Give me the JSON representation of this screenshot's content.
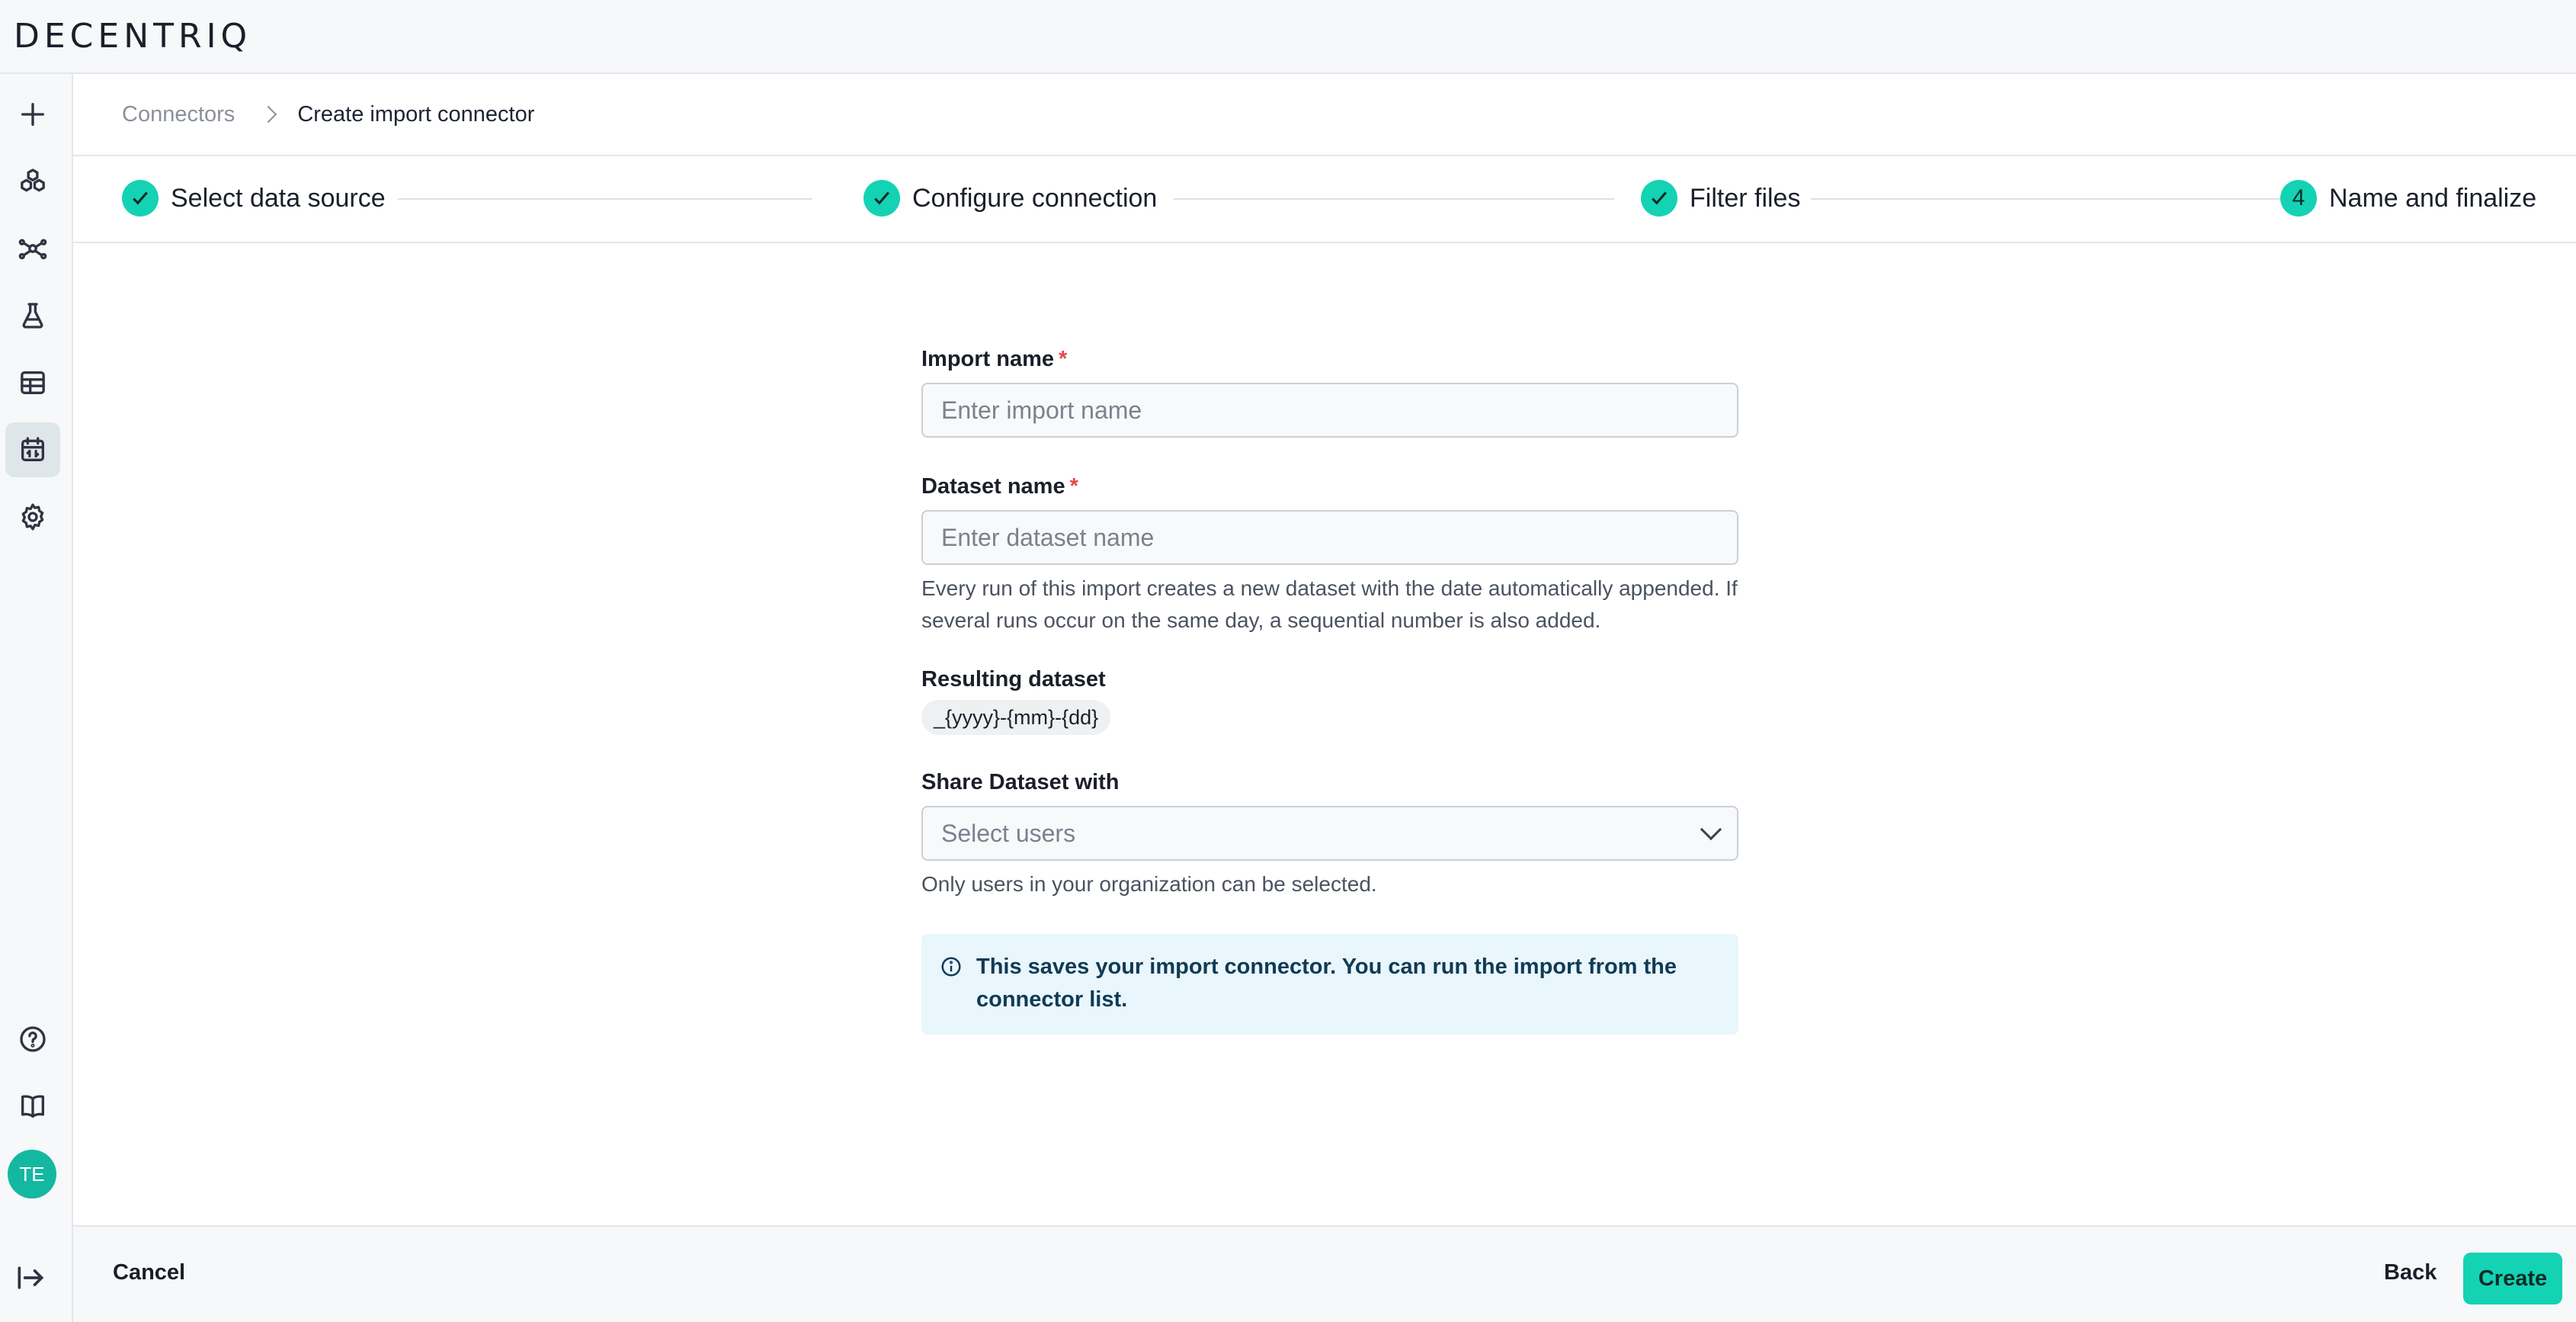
{
  "app": {
    "logo": "DECENTRIQ"
  },
  "sidebar": {
    "items": [
      {
        "icon": "plus-icon"
      },
      {
        "icon": "datarooms-icon"
      },
      {
        "icon": "network-icon"
      },
      {
        "icon": "flask-icon"
      },
      {
        "icon": "table-icon"
      },
      {
        "icon": "connectors-icon",
        "active": true
      },
      {
        "icon": "gear-icon"
      }
    ],
    "bottom": [
      {
        "icon": "help-icon"
      },
      {
        "icon": "book-icon"
      }
    ],
    "avatar": "TE"
  },
  "breadcrumb": {
    "parent": "Connectors",
    "current": "Create import connector"
  },
  "stepper": {
    "steps": [
      {
        "label": "Select data source",
        "state": "done"
      },
      {
        "label": "Configure connection",
        "state": "done"
      },
      {
        "label": "Filter files",
        "state": "done"
      },
      {
        "label": "Name and finalize",
        "state": "current",
        "number": "4"
      }
    ]
  },
  "form": {
    "import_name": {
      "label": "Import name",
      "required": "*",
      "placeholder": "Enter import name",
      "value": ""
    },
    "dataset_name": {
      "label": "Dataset name",
      "required": "*",
      "placeholder": "Enter dataset name",
      "value": "",
      "help": "Every run of this import creates a new dataset with the date automatically appended. If several runs occur on the same day, a sequential number is also added."
    },
    "resulting_dataset": {
      "label": "Resulting dataset",
      "value": "_{yyyy}-{mm}-{dd}"
    },
    "share": {
      "label": "Share Dataset with",
      "placeholder": "Select users",
      "help": "Only users in your organization can be selected."
    },
    "info": "This saves your import connector. You can run the import from the connector list."
  },
  "footer": {
    "cancel": "Cancel",
    "back": "Back",
    "create": "Create"
  },
  "colors": {
    "accent": "#14d2b4",
    "avatar": "#14b8a0",
    "info_bg": "#e9f6fb",
    "required": "#e5484d"
  }
}
